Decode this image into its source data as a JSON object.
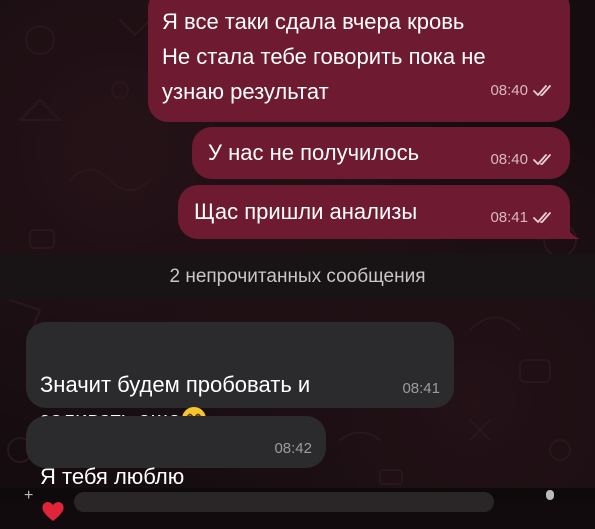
{
  "chat": {
    "messages": [
      {
        "direction": "outgoing",
        "text": "Я все таки сдала вчера кровь\nНе стала тебе говорить пока не\nузнаю результат",
        "time": "08:40",
        "status": "read"
      },
      {
        "direction": "outgoing",
        "text": "У нас не получилось",
        "time": "08:40",
        "status": "read"
      },
      {
        "direction": "outgoing",
        "text": "Щас пришли анализы",
        "time": "08:41",
        "status": "read"
      },
      {
        "direction": "incoming",
        "text": "Значит будем пробовать и\nзаливать еще",
        "emoji": "grinning-face-emoji",
        "time": "08:41"
      },
      {
        "direction": "incoming",
        "text": "Я тебя люблю",
        "emoji": "red-heart-emoji",
        "time": "08:42"
      }
    ],
    "unread_separator": "2 непрочитанных сообщения"
  },
  "colors": {
    "outgoing_bubble": "#6e1b31",
    "incoming_bubble": "#2b2b2d",
    "background": "#140c0f"
  },
  "icons": {
    "read_status": "double-check-icon",
    "attach": "attach-icon",
    "mic": "microphone-icon"
  }
}
